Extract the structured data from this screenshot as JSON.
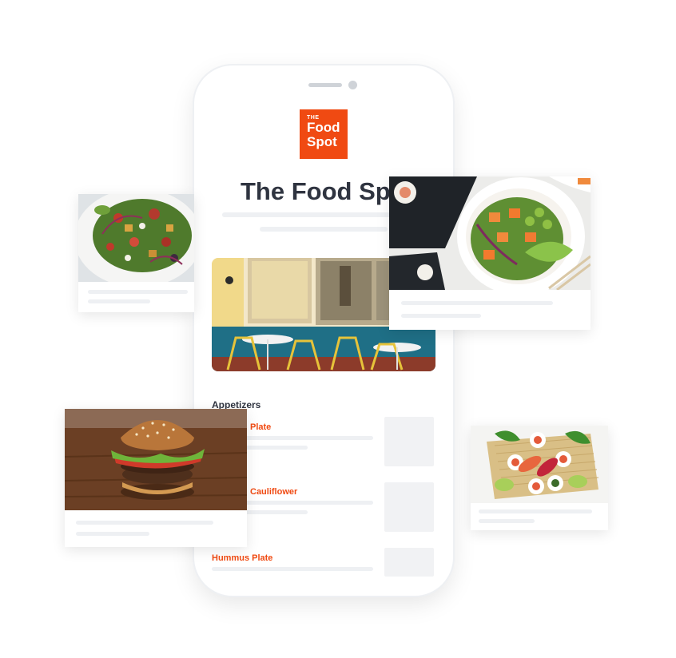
{
  "restaurant": {
    "logo_the": "THE",
    "logo_food": "Food",
    "logo_spot": "Spot",
    "name": "The Food Spot",
    "brand_color": "#f04a12"
  },
  "menu": {
    "section_title": "Appetizers",
    "items": [
      {
        "label": "Plate"
      },
      {
        "label": "Cauliflower"
      },
      {
        "label": "Hummus Plate"
      }
    ]
  },
  "cards": [
    {
      "photo": "salad-photo"
    },
    {
      "photo": "poke-bowl-photo"
    },
    {
      "photo": "burger-photo"
    },
    {
      "photo": "sushi-photo"
    }
  ]
}
